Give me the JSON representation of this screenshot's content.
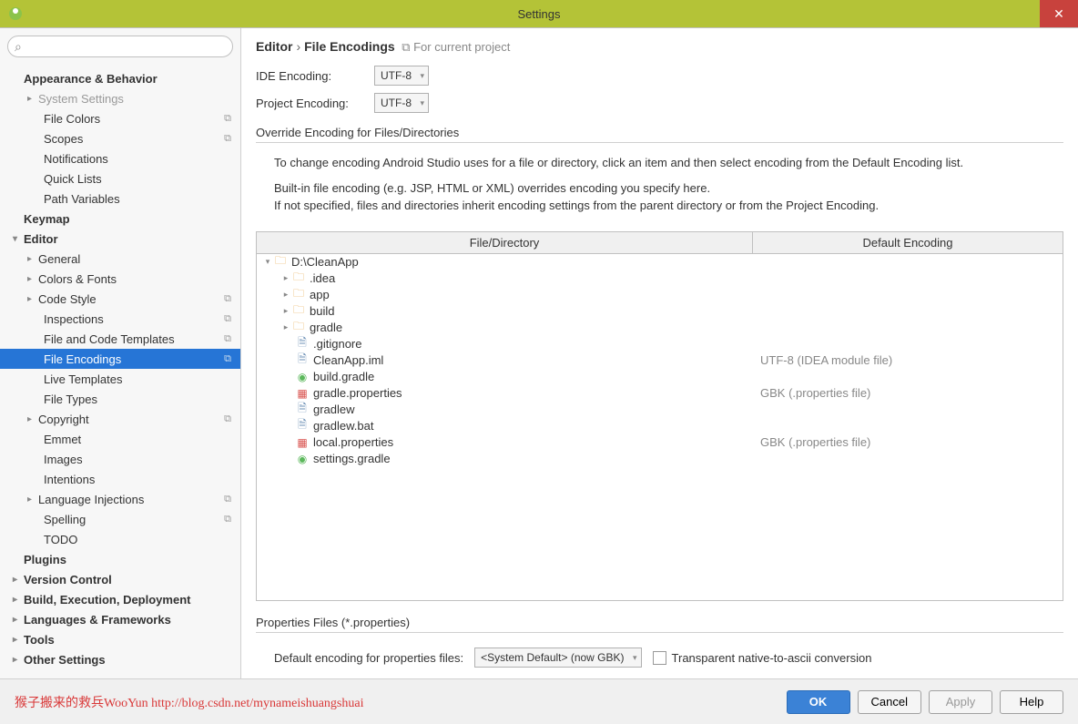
{
  "window": {
    "title": "Settings"
  },
  "breadcrumb": {
    "editor": "Editor",
    "page": "File Encodings",
    "scope": "For current project"
  },
  "form": {
    "ide_label": "IDE Encoding:",
    "ide_value": "UTF-8",
    "project_label": "Project Encoding:",
    "project_value": "UTF-8"
  },
  "section": {
    "override_title": "Override Encoding for Files/Directories",
    "properties_title": "Properties Files (*.properties)"
  },
  "info": {
    "p1": "To change encoding Android Studio uses for a file or directory, click an item and then select encoding from the Default Encoding list.",
    "p2": "Built-in file encoding (e.g. JSP, HTML or XML) overrides encoding you specify here.",
    "p3": "If not specified, files and directories inherit encoding settings from the parent directory or from the Project Encoding."
  },
  "table": {
    "col1": "File/Directory",
    "col2": "Default Encoding"
  },
  "files": {
    "root": "D:\\CleanApp",
    "idea": ".idea",
    "app": "app",
    "build": "build",
    "gradle": "gradle",
    "gitignore": ".gitignore",
    "iml": "CleanApp.iml",
    "iml_enc": "UTF-8 (IDEA module file)",
    "bgradle": "build.gradle",
    "gprops": "gradle.properties",
    "gprops_enc": "GBK (.properties file)",
    "gradlew": "gradlew",
    "gradlewbat": "gradlew.bat",
    "lprops": "local.properties",
    "lprops_enc": "GBK (.properties file)",
    "sgradle": "settings.gradle"
  },
  "props": {
    "default_label": "Default encoding for properties files:",
    "default_value": "<System Default> (now GBK)",
    "transparent": "Transparent native-to-ascii conversion"
  },
  "sidebar": {
    "appearance": "Appearance & Behavior",
    "system": "System Settings",
    "filecolors": "File Colors",
    "scopes": "Scopes",
    "notifications": "Notifications",
    "quicklists": "Quick Lists",
    "pathvars": "Path Variables",
    "keymap": "Keymap",
    "editor": "Editor",
    "general": "General",
    "colorsfonts": "Colors & Fonts",
    "codestyle": "Code Style",
    "inspections": "Inspections",
    "templates": "File and Code Templates",
    "encodings": "File Encodings",
    "livetemplates": "Live Templates",
    "filetypes": "File Types",
    "copyright": "Copyright",
    "emmet": "Emmet",
    "images": "Images",
    "intentions": "Intentions",
    "langinject": "Language Injections",
    "spelling": "Spelling",
    "todo": "TODO",
    "plugins": "Plugins",
    "versioncontrol": "Version Control",
    "build": "Build, Execution, Deployment",
    "langframe": "Languages & Frameworks",
    "tools": "Tools",
    "other": "Other Settings"
  },
  "buttons": {
    "ok": "OK",
    "cancel": "Cancel",
    "apply": "Apply",
    "help": "Help"
  },
  "watermark": "猴子搬来的救兵WooYun http://blog.csdn.net/mynameishuangshuai"
}
